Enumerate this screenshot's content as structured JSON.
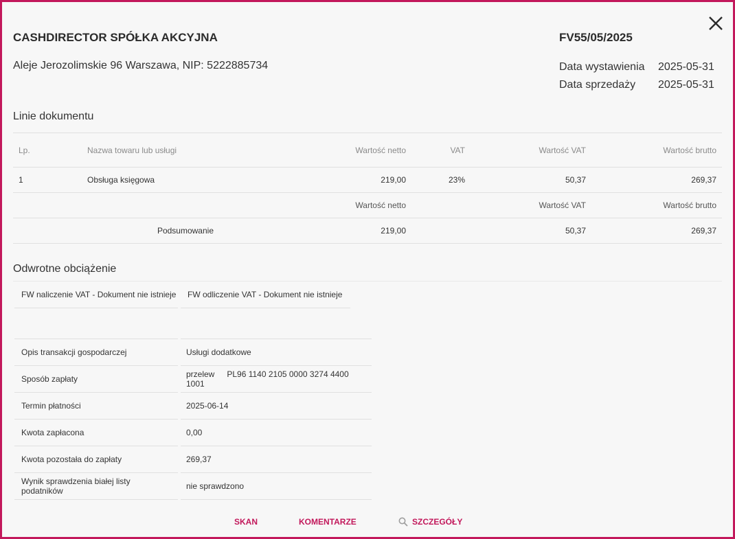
{
  "header": {
    "company": "CASHDIRECTOR SPÓŁKA AKCYJNA",
    "address": "Aleje Jerozolimskie 96 Warszawa, NIP: 5222885734",
    "doc_number": "FV55/05/2025",
    "issue_label": "Data wystawienia",
    "issue_date": "2025-05-31",
    "sale_label": "Data sprzedaży",
    "sale_date": "2025-05-31",
    "close_icon": "close-icon"
  },
  "lines": {
    "title": "Linie dokumentu",
    "columns": [
      "Lp.",
      "Nazwa towaru lub usługi",
      "Wartość netto",
      "VAT",
      "Wartość VAT",
      "Wartość brutto"
    ],
    "rows": [
      {
        "lp": "1",
        "name": "Obsługa księgowa",
        "net": "219,00",
        "vat": "23%",
        "vat_value": "50,37",
        "gross": "269,37"
      }
    ],
    "summary_headers": {
      "net": "Wartość netto",
      "vat_value": "Wartość VAT",
      "gross": "Wartość brutto"
    },
    "summary": {
      "label": "Podsumowanie",
      "net": "219,00",
      "vat_value": "50,37",
      "gross": "269,37"
    }
  },
  "reverse_charge": {
    "title": "Odwrotne obciążenie",
    "vat_charge": "FW naliczenie VAT - Dokument nie istnieje",
    "vat_deduction": "FW odliczenie VAT - Dokument nie istnieje"
  },
  "details": [
    {
      "label": "Opis transakcji gospodarczej",
      "value": "Usługi dodatkowe"
    },
    {
      "label": "Sposób zapłaty",
      "value": "przelew",
      "extra": "PL96 1140 2105 0000 3274 4400 1001"
    },
    {
      "label": "Termin płatności",
      "value": "2025-06-14"
    },
    {
      "label": "Kwota zapłacona",
      "value": "0,00"
    },
    {
      "label": "Kwota pozostała do zapłaty",
      "value": "269,37"
    },
    {
      "label": "Wynik sprawdzenia białej listy podatników",
      "value": "nie sprawdzono"
    }
  ],
  "actions": {
    "scan": "SKAN",
    "comments": "KOMENTARZE",
    "details": "SZCZEGÓŁY",
    "details_icon": "search-icon"
  },
  "colors": {
    "accent": "#c2185b",
    "background": "#f7f7f7",
    "border": "#e0e0e0"
  }
}
